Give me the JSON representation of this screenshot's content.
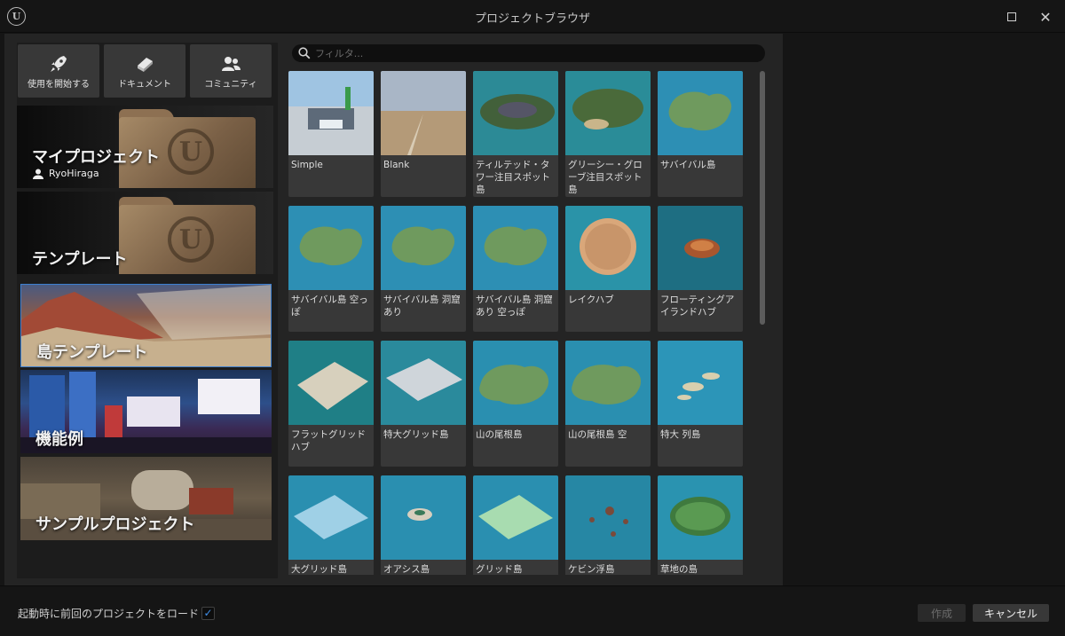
{
  "window": {
    "title": "プロジェクトブラウザ",
    "logo_glyph": "U"
  },
  "toolbar": [
    {
      "label": "使用を開始する",
      "icon": "rocket-icon"
    },
    {
      "label": "ドキュメント",
      "icon": "book-icon"
    },
    {
      "label": "コミュニティ",
      "icon": "people-icon"
    }
  ],
  "categories": {
    "my_projects": {
      "label": "マイプロジェクト",
      "user": "RyoHiraga"
    },
    "templates": {
      "label": "テンプレート"
    },
    "island_templates": {
      "label": "島テンプレート",
      "selected": true
    },
    "feature_examples": {
      "label": "機能例"
    },
    "sample_projects": {
      "label": "サンプルプロジェクト"
    }
  },
  "search": {
    "placeholder": "フィルタ..."
  },
  "templates": [
    {
      "label": "Simple"
    },
    {
      "label": "Blank"
    },
    {
      "label": "ティルテッド・タワー注目スポット島"
    },
    {
      "label": "グリーシー・グローブ注目スポット島"
    },
    {
      "label": "サバイバル島"
    },
    {
      "label": "サバイバル島 空っぽ"
    },
    {
      "label": "サバイバル島 洞窟あり"
    },
    {
      "label": "サバイバル島 洞窟あり 空っぽ"
    },
    {
      "label": "レイクハブ"
    },
    {
      "label": "フローティングアイランドハブ"
    },
    {
      "label": "フラットグリッドハブ"
    },
    {
      "label": "特大グリッド島"
    },
    {
      "label": "山の尾根島"
    },
    {
      "label": "山の尾根島 空"
    },
    {
      "label": "特大 列島"
    },
    {
      "label": "大グリッド島"
    },
    {
      "label": "オアシス島"
    },
    {
      "label": "グリッド島"
    },
    {
      "label": "ケビン浮島"
    },
    {
      "label": "草地の島"
    }
  ],
  "footer": {
    "load_last_label": "起動時に前回のプロジェクトをロード",
    "load_last_checked": true,
    "check_glyph": "✓",
    "create_label": "作成",
    "cancel_label": "キャンセル"
  },
  "colors": {
    "accent": "#3f8ee8",
    "panel": "#242424",
    "tile": "#383838"
  }
}
